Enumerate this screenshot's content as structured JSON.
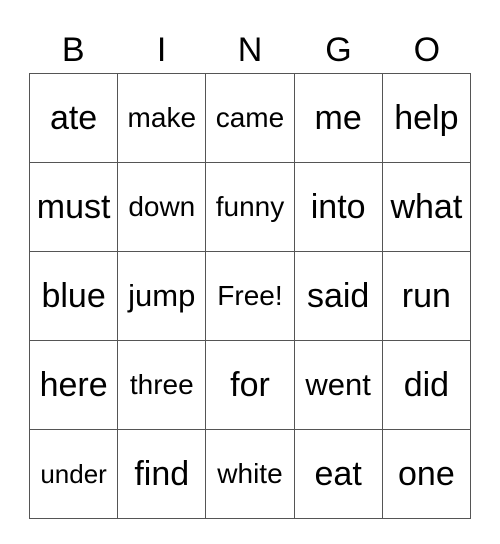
{
  "header": [
    "B",
    "I",
    "N",
    "G",
    "O"
  ],
  "rows": [
    [
      "ate",
      "make",
      "came",
      "me",
      "help"
    ],
    [
      "must",
      "down",
      "funny",
      "into",
      "what"
    ],
    [
      "blue",
      "jump",
      "Free!",
      "said",
      "run"
    ],
    [
      "here",
      "three",
      "for",
      "went",
      "did"
    ],
    [
      "under",
      "find",
      "white",
      "eat",
      "one"
    ]
  ]
}
